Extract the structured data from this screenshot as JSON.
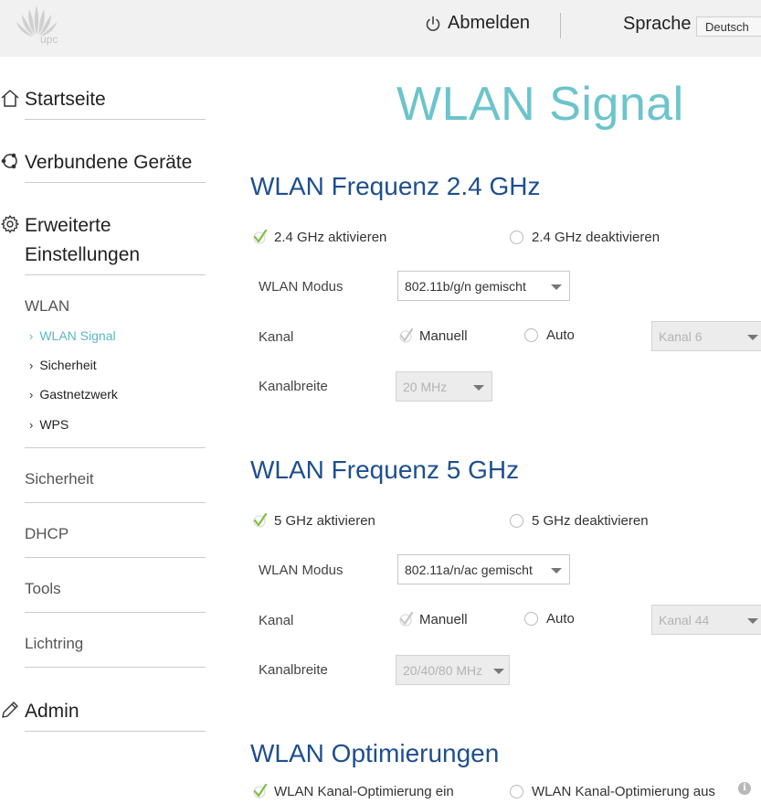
{
  "header": {
    "logo_text": "upc",
    "logout_label": "Abmelden",
    "language_label": "Sprache",
    "language_value": "Deutsch"
  },
  "sidebar": {
    "main_items": [
      {
        "label": "Startseite",
        "icon": "home-icon"
      },
      {
        "label": "Verbundene Geräte",
        "icon": "devices-icon"
      },
      {
        "label": "Erweiterte Einstellungen",
        "icon": "gear-icon"
      },
      {
        "label": "Admin",
        "icon": "pencil-icon"
      }
    ],
    "wlan_heading": "WLAN",
    "wlan_sub": [
      "WLAN Signal",
      "Sicherheit",
      "Gastnetzwerk",
      "WPS"
    ],
    "active_sub": "WLAN Signal",
    "sections": [
      "Sicherheit",
      "DHCP",
      "Tools",
      "Lichtring"
    ]
  },
  "main": {
    "title": "WLAN Signal",
    "band24": {
      "title": "WLAN Frequenz 2.4 GHz",
      "enable_label": "2.4 GHz aktivieren",
      "disable_label": "2.4 GHz deaktivieren",
      "mode_label": "WLAN Modus",
      "mode_value": "802.11b/g/n gemischt",
      "channel_label": "Kanal",
      "manual_label": "Manuell",
      "auto_label": "Auto",
      "channel_value": "Kanal 6",
      "width_label": "Kanalbreite",
      "width_value": "20 MHz"
    },
    "band5": {
      "title": "WLAN Frequenz 5 GHz",
      "enable_label": "5 GHz aktivieren",
      "disable_label": "5 GHz deaktivieren",
      "mode_label": "WLAN Modus",
      "mode_value": "802.11a/n/ac gemischt",
      "channel_label": "Kanal",
      "manual_label": "Manuell",
      "auto_label": "Auto",
      "channel_value": "Kanal 44",
      "width_label": "Kanalbreite",
      "width_value": "20/40/80 MHz"
    },
    "optim": {
      "title": "WLAN Optimierungen",
      "on_label": "WLAN Kanal-Optimierung ein",
      "off_label": "WLAN Kanal-Optimierung aus",
      "info_glyph": "i"
    }
  },
  "colors": {
    "title_teal": "#6cc4cc",
    "section_blue": "#1e4f8f",
    "active_link": "#5bb8c5",
    "check_green": "#7dc242"
  }
}
